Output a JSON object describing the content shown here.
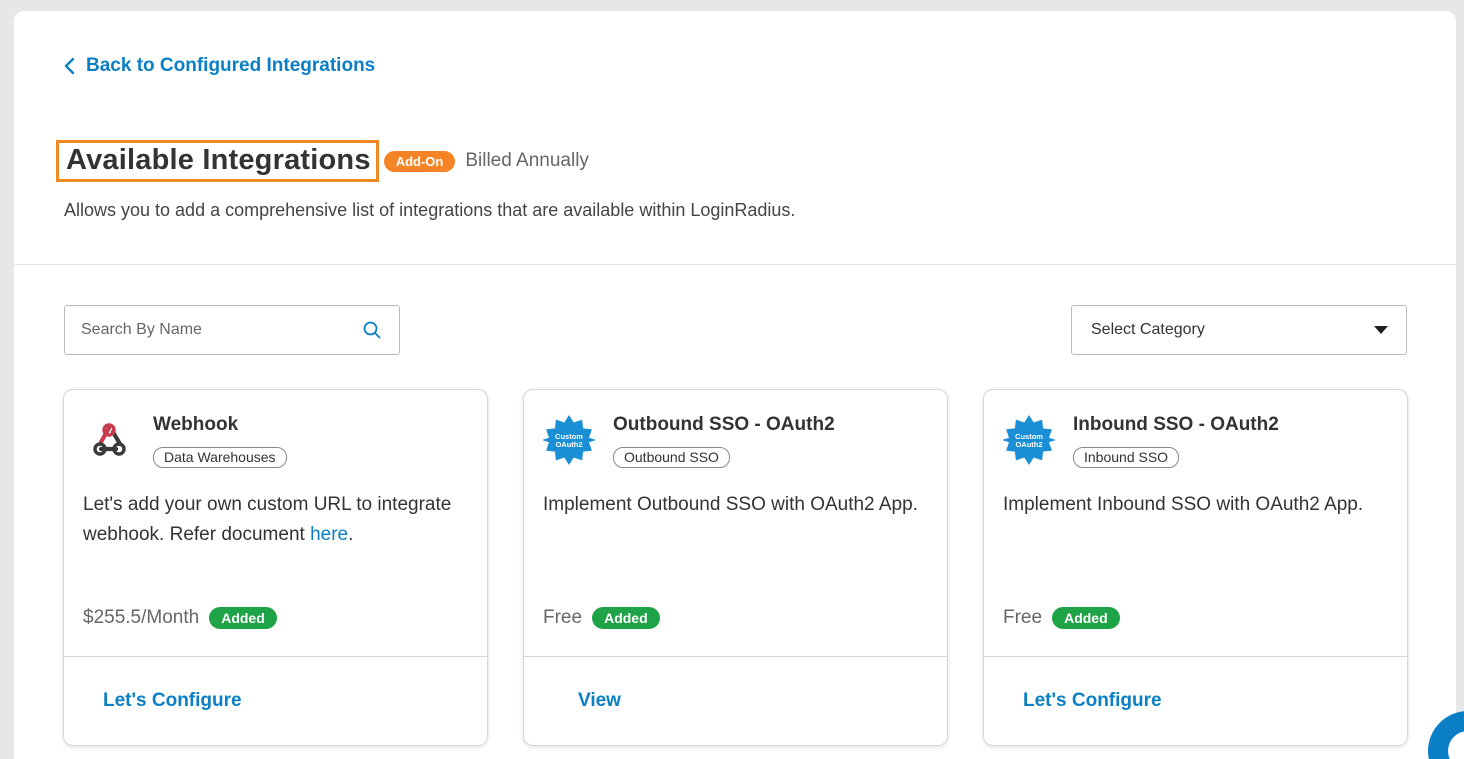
{
  "nav": {
    "back_label": "Back to Configured Integrations"
  },
  "header": {
    "title": "Available Integrations",
    "addon_badge": "Add-On",
    "billing": "Billed Annually",
    "description": "Allows you to add a comprehensive list of integrations that are available within LoginRadius."
  },
  "filters": {
    "search_placeholder": "Search By Name",
    "search_value": "",
    "category_selected": "Select Category"
  },
  "cards": [
    {
      "name": "Webhook",
      "tag": "Data Warehouses",
      "description_prefix": "Let's add your own custom URL to integrate webhook. Refer document ",
      "description_link": "here",
      "description_suffix": ".",
      "price": "$255.5/Month",
      "status": "Added",
      "action": "Let's Configure",
      "icon": "webhook-icon"
    },
    {
      "name": "Outbound SSO - OAuth2",
      "tag": "Outbound SSO",
      "description": "Implement Outbound SSO with OAuth2 App.",
      "price": "Free",
      "status": "Added",
      "action": "View",
      "icon": "custom-oauth2-icon",
      "icon_text_1": "Custom",
      "icon_text_2": "OAuth2"
    },
    {
      "name": "Inbound SSO - OAuth2",
      "tag": "Inbound SSO",
      "description": "Implement Inbound SSO with OAuth2 App.",
      "price": "Free",
      "status": "Added",
      "action": "Let's Configure",
      "icon": "custom-oauth2-icon",
      "icon_text_1": "Custom",
      "icon_text_2": "OAuth2"
    }
  ],
  "colors": {
    "link_blue": "#0b7fc6",
    "addon_orange": "#f58426",
    "added_green": "#1ea446",
    "highlight_border": "#f08a24"
  }
}
